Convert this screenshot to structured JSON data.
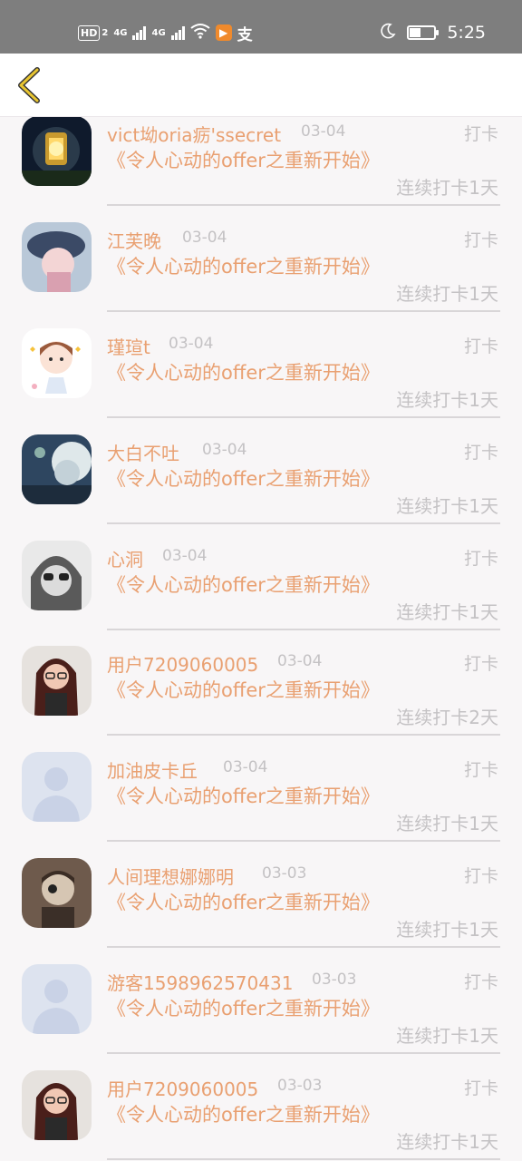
{
  "status_bar": {
    "hd_label": "HD",
    "hd_sub": "2",
    "net1": "4G",
    "net2": "4G",
    "app_badge": "▶",
    "pay_glyph": "支",
    "time": "5:25",
    "icons": [
      "wifi-icon",
      "moon-icon",
      "battery-icon"
    ],
    "battery_level": 0.45
  },
  "header": {
    "back_icon": "chevron-left-icon",
    "accent": "#e8c531"
  },
  "colors": {
    "name": "#e9a071",
    "meta": "#c4c2c4",
    "background": "#f8f6f7"
  },
  "items": [
    {
      "name": "vict坳oria疬'ssecret",
      "date": "03-04",
      "action": "打卡",
      "book": "《令人心动的offer之重新开始》",
      "streak": "连续打卡1天",
      "avatar": "lantern"
    },
    {
      "name": "江芙晚",
      "date": "03-04",
      "action": "打卡",
      "book": "《令人心动的offer之重新开始》",
      "streak": "连续打卡1天",
      "avatar": "hat-girl"
    },
    {
      "name": "瑾瑄t",
      "date": "03-04",
      "action": "打卡",
      "book": "《令人心动的offer之重新开始》",
      "streak": "连续打卡1天",
      "avatar": "cartoon-girl"
    },
    {
      "name": "大白不吐",
      "date": "03-04",
      "action": "打卡",
      "book": "《令人心动的offer之重新开始》",
      "streak": "连续打卡1天",
      "avatar": "fantasy"
    },
    {
      "name": "心洞",
      "date": "03-04",
      "action": "打卡",
      "book": "《令人心动的offer之重新开始》",
      "streak": "连续打卡1天",
      "avatar": "sunglasses"
    },
    {
      "name": "用户7209060005",
      "date": "03-04",
      "action": "打卡",
      "book": "《令人心动的offer之重新开始》",
      "streak": "连续打卡2天",
      "avatar": "glasses-woman"
    },
    {
      "name": "加油皮卡丘",
      "date": "03-04",
      "action": "打卡",
      "book": "《令人心动的offer之重新开始》",
      "streak": "连续打卡1天",
      "avatar": "default"
    },
    {
      "name": "人间理想娜娜明",
      "date": "03-03",
      "action": "打卡",
      "book": "《令人心动的offer之重新开始》",
      "streak": "连续打卡1天",
      "avatar": "sepia-man"
    },
    {
      "name": "游客1598962570431",
      "date": "03-03",
      "action": "打卡",
      "book": "《令人心动的offer之重新开始》",
      "streak": "连续打卡1天",
      "avatar": "default"
    },
    {
      "name": "用户7209060005",
      "date": "03-03",
      "action": "打卡",
      "book": "《令人心动的offer之重新开始》",
      "streak": "连续打卡1天",
      "avatar": "glasses-woman"
    }
  ]
}
